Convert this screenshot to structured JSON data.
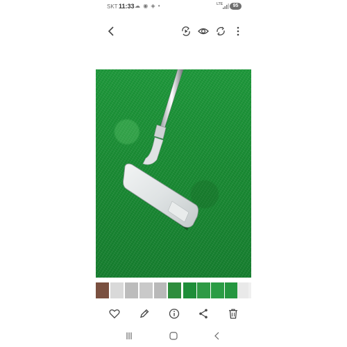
{
  "status_bar": {
    "carrier": "SKT",
    "time": "11:33",
    "notification_icons": "☁ ◉ ◈ •",
    "network": "LTE",
    "battery": "95"
  },
  "top_bar": {
    "icons": [
      "back-arrow-icon",
      "remaster-icon",
      "eye-icon",
      "refresh-rotate-icon",
      "more-vert-icon"
    ]
  },
  "photo": {
    "subject": "putter",
    "background": "#1a8c34"
  },
  "thumbnails": {
    "count": 12,
    "selected_index": 5,
    "colors": [
      "#7a5040",
      "#d9d9d9",
      "#bcbcbc",
      "#c9c9c9",
      "#b9b9b9",
      "#2e8d3d",
      "#1e8e39",
      "#2e9a45",
      "#2a9c44",
      "#24963f",
      "#e9e9e9",
      "#f0f0f0"
    ]
  },
  "actions": {
    "icons": [
      "heart-icon",
      "edit-pencil-icon",
      "info-icon",
      "share-icon",
      "trash-icon"
    ]
  },
  "nav": {
    "icons": [
      "recents-icon",
      "home-icon",
      "back-nav-icon"
    ]
  },
  "colors": {
    "icon": "#555555",
    "grass": "#1a8c34"
  }
}
